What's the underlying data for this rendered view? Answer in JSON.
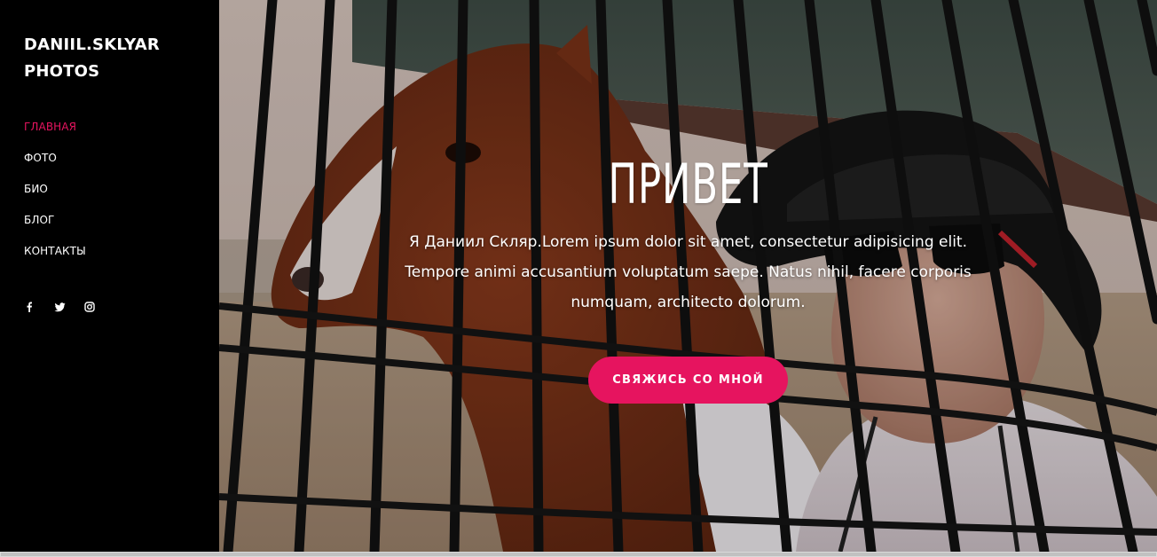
{
  "brand": {
    "line1": "DANIIL.SKLYAR",
    "line2": "PHOTOS"
  },
  "nav": {
    "items": [
      {
        "label": "ГЛАВНАЯ",
        "active": true
      },
      {
        "label": "ФОТО",
        "active": false
      },
      {
        "label": "БИО",
        "active": false
      },
      {
        "label": "БЛОГ",
        "active": false
      },
      {
        "label": "КОНТАКТЫ",
        "active": false
      }
    ]
  },
  "social": {
    "icons": [
      "facebook-icon",
      "twitter-icon",
      "instagram-icon"
    ]
  },
  "hero": {
    "title": "ПРИВЕТ",
    "text": "Я Даниил Скляр.Lorem ipsum dolor sit amet, consectetur adipisicing elit. Tempore animi accusantium voluptatum saepe. Natus nihil, facere corporis numquam, architecto dolorum.",
    "cta_label": "СВЯЖИСЬ СО МНОЙ"
  },
  "colors": {
    "accent": "#e6145f",
    "sidebar_bg": "#000000",
    "text": "#ffffff"
  }
}
